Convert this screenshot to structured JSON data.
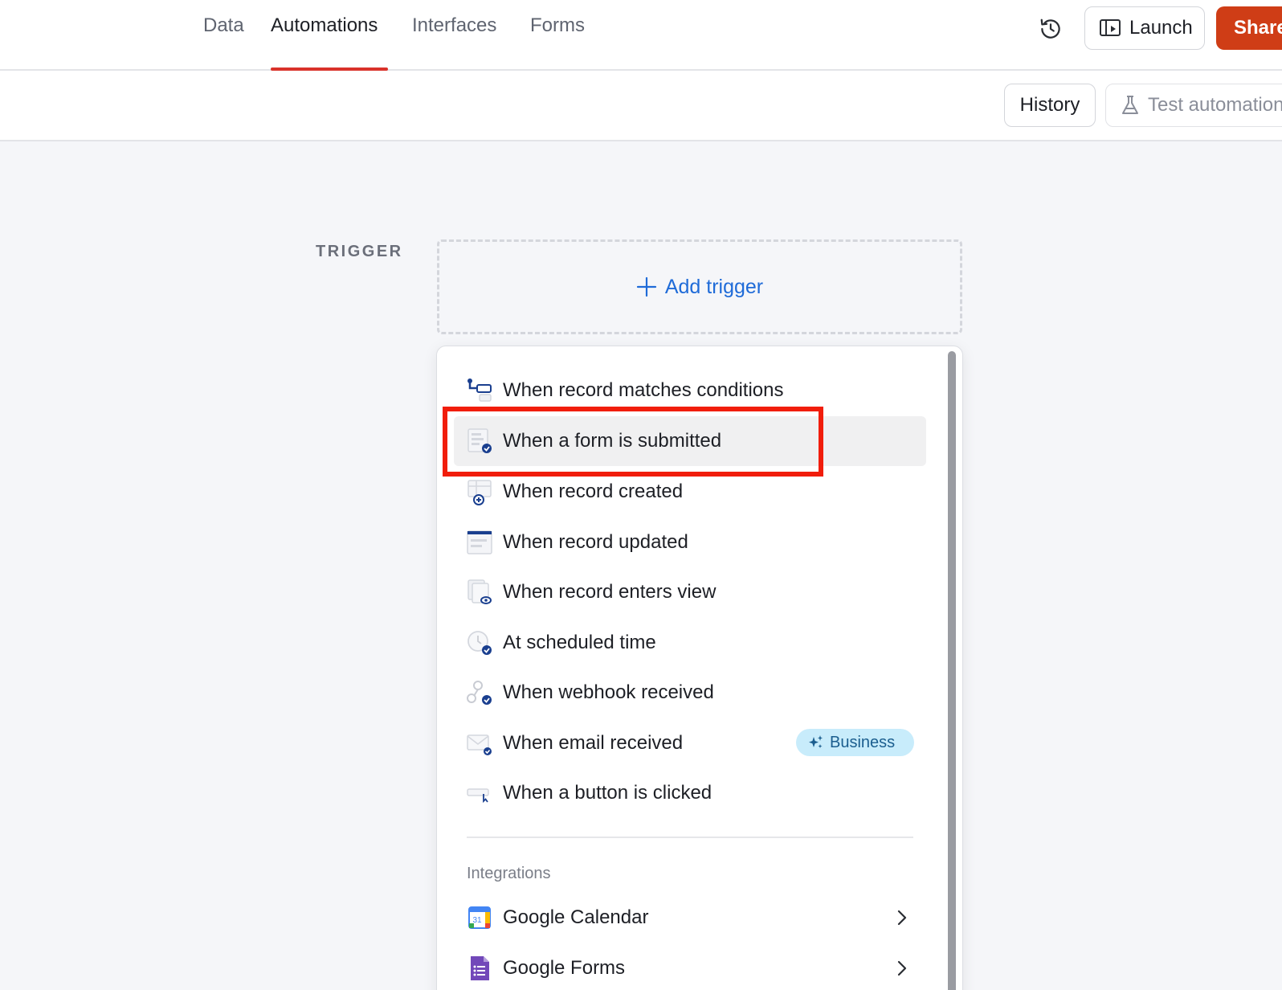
{
  "nav": {
    "tabs": [
      {
        "label": "Data"
      },
      {
        "label": "Automations"
      },
      {
        "label": "Interfaces"
      },
      {
        "label": "Forms"
      }
    ],
    "active_tab": "Automations",
    "launch_label": "Launch",
    "share_label": "Share"
  },
  "toolbar": {
    "history_label": "History",
    "test_label": "Test automation"
  },
  "canvas": {
    "trigger_section_label": "TRIGGER",
    "add_trigger_label": "Add trigger"
  },
  "trigger_menu": {
    "items": [
      {
        "label": "When record matches conditions",
        "icon": "conditions-icon"
      },
      {
        "label": "When a form is submitted",
        "icon": "form-submitted-icon"
      },
      {
        "label": "When record created",
        "icon": "record-created-icon"
      },
      {
        "label": "When record updated",
        "icon": "record-updated-icon"
      },
      {
        "label": "When record enters view",
        "icon": "record-enters-view-icon"
      },
      {
        "label": "At scheduled time",
        "icon": "clock-icon"
      },
      {
        "label": "When webhook received",
        "icon": "webhook-icon"
      },
      {
        "label": "When email received",
        "icon": "email-icon",
        "badge": "Business"
      },
      {
        "label": "When a button is clicked",
        "icon": "button-clicked-icon"
      }
    ],
    "integrations_label": "Integrations",
    "integrations": [
      {
        "label": "Google Calendar",
        "icon": "google-calendar-icon",
        "icon_text": "31"
      },
      {
        "label": "Google Forms",
        "icon": "google-forms-icon"
      }
    ]
  },
  "colors": {
    "accent_red": "#d9322a",
    "share_orange": "#cf3d16",
    "link_blue": "#1f6bd8",
    "badge_bg": "#c8ecfb",
    "annotation_red": "#f11d0b"
  }
}
